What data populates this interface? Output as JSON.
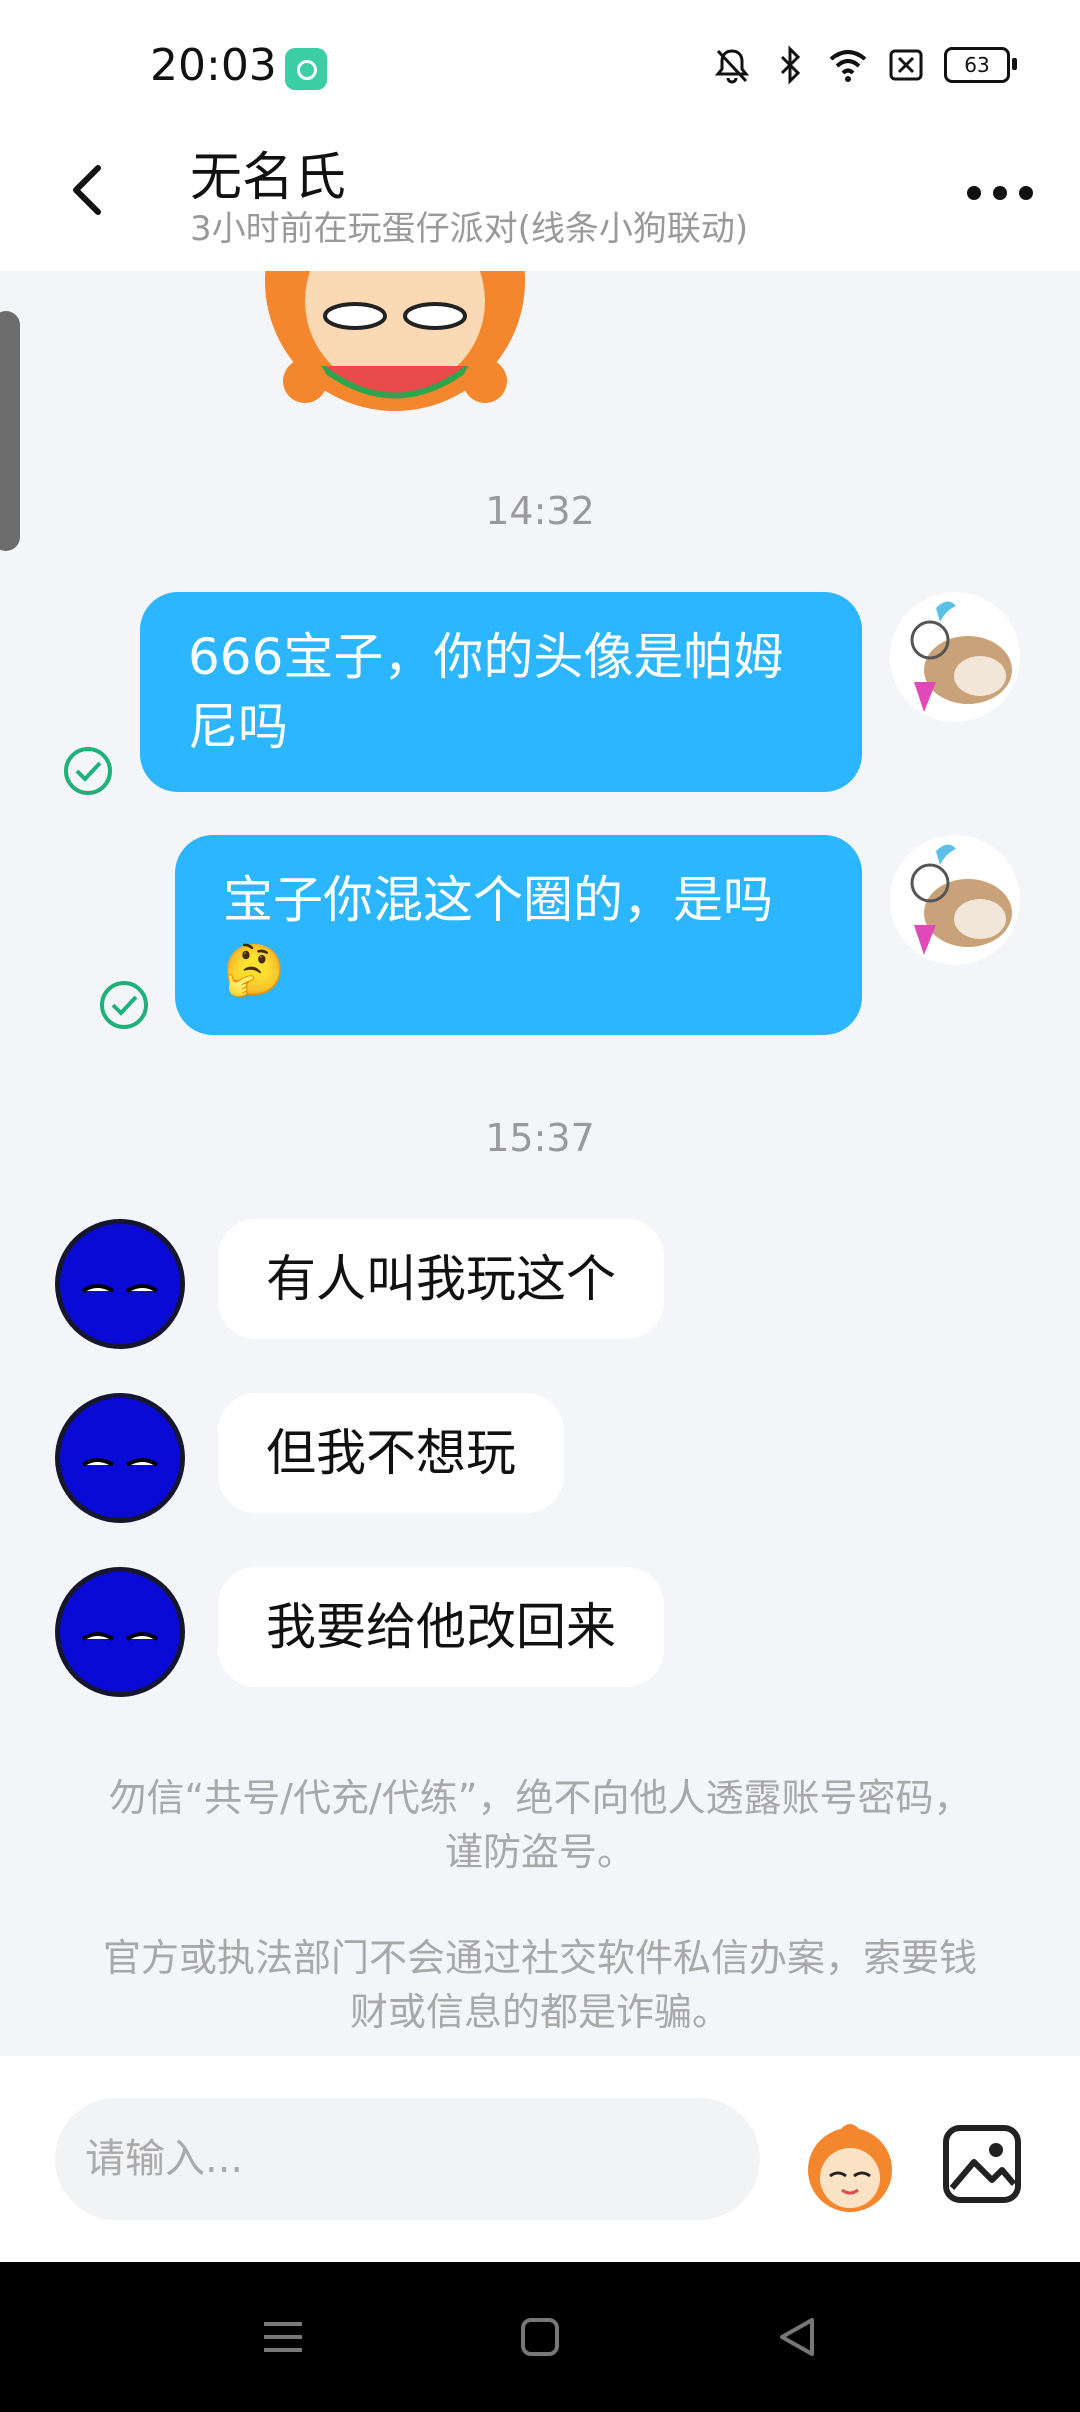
{
  "status_bar": {
    "time": "20:03",
    "battery": "63",
    "icons": [
      "app-notification-icon",
      "silent-bell-icon",
      "bluetooth-icon",
      "wifi-icon",
      "no-sim-icon",
      "battery-icon"
    ]
  },
  "header": {
    "title": "无名氏",
    "subtitle": "3小时前在玩蛋仔派对(线条小狗联动)",
    "back_icon": "back-chevron-icon",
    "more_icon": "more-dots-icon"
  },
  "messages": [
    {
      "type": "time",
      "text": "14:32"
    },
    {
      "type": "sent",
      "text": "666宝子，你的头像是帕姆尼吗",
      "status": "read"
    },
    {
      "type": "sent",
      "text": "宝子你混这个圈的，是吗🤔",
      "status": "read"
    },
    {
      "type": "time",
      "text": "15:37"
    },
    {
      "type": "received",
      "text": "有人叫我玩这个"
    },
    {
      "type": "received",
      "text": "但我不想玩"
    },
    {
      "type": "received",
      "text": "我要给他改回来"
    }
  ],
  "notices": [
    "勿信“共号/代充/代练”，绝不向他人透露账号密码，谨防盗号。",
    "官方或执法部门不会通过社交软件私信办案，索要钱财或信息的都是诈骗。"
  ],
  "input": {
    "placeholder": "请输入...",
    "value": "",
    "emoji_icon": "emoji-sticker-icon",
    "image_icon": "image-icon"
  },
  "nav_bar": {
    "icons": [
      "menu-icon",
      "home-square-icon",
      "back-triangle-icon"
    ]
  },
  "colors": {
    "sent_bubble": "#2bb6ff",
    "received_bubble": "#ffffff",
    "background": "#f3f5f9",
    "read_check": "#20b07a"
  }
}
